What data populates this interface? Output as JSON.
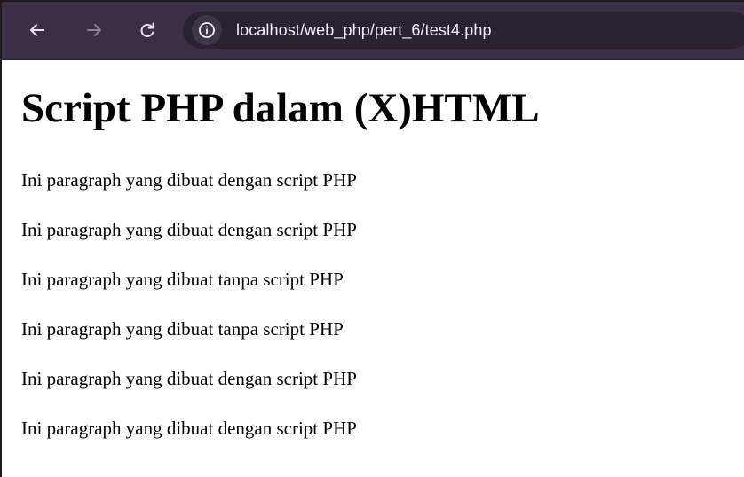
{
  "browser": {
    "url": "localhost/web_php/pert_6/test4.php",
    "icons": {
      "back": "arrow-left-icon",
      "forward": "arrow-right-icon",
      "reload": "reload-icon",
      "site_info": "info-icon"
    },
    "colors": {
      "toolbar": "#3a2f45",
      "omnibox": "#2a2231"
    }
  },
  "page": {
    "title": "Script PHP dalam (X)HTML",
    "paragraphs": [
      "Ini paragraph yang dibuat dengan script PHP",
      "Ini paragraph yang dibuat dengan script PHP",
      "Ini paragraph yang dibuat tanpa script PHP",
      "Ini paragraph yang dibuat tanpa script PHP",
      "Ini paragraph yang dibuat dengan script PHP",
      "Ini paragraph yang dibuat dengan script PHP"
    ]
  }
}
